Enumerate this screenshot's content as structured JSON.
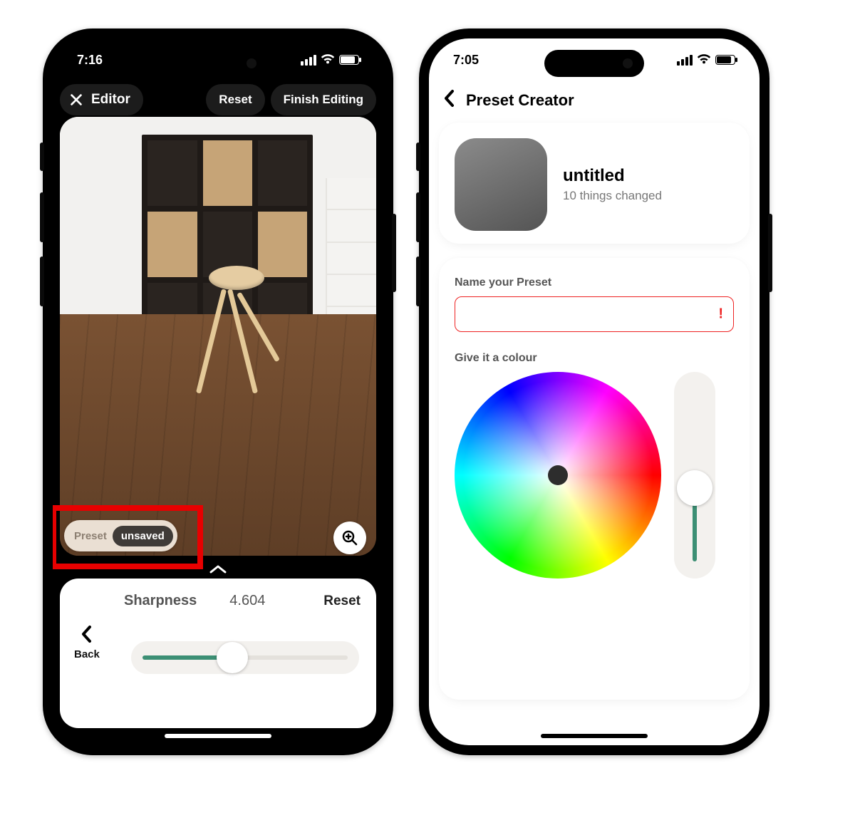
{
  "left": {
    "status_time": "7:16",
    "header": {
      "title": "Editor",
      "reset": "Reset",
      "finish": "Finish Editing"
    },
    "preset_chip": {
      "label": "Preset",
      "status": "unsaved"
    },
    "panel": {
      "param_name": "Sharpness",
      "param_value": "4.604",
      "reset": "Reset",
      "back": "Back"
    },
    "icons": {
      "close": "close-icon",
      "zoom": "magnify-plus-icon",
      "chevron_up": "chevron-up-icon",
      "chevron_left": "chevron-left-icon"
    }
  },
  "right": {
    "status_time": "7:05",
    "header": {
      "title": "Preset Creator"
    },
    "preset": {
      "name": "untitled",
      "subtitle": "10 things changed"
    },
    "form": {
      "name_label": "Name your Preset",
      "name_value": "",
      "name_error": "!",
      "colour_label": "Give it a colour"
    },
    "icons": {
      "back": "chevron-left-icon"
    },
    "colors": {
      "swatch": "#6f6f6f",
      "error": "#e02424",
      "accent": "#3c8f74"
    }
  }
}
